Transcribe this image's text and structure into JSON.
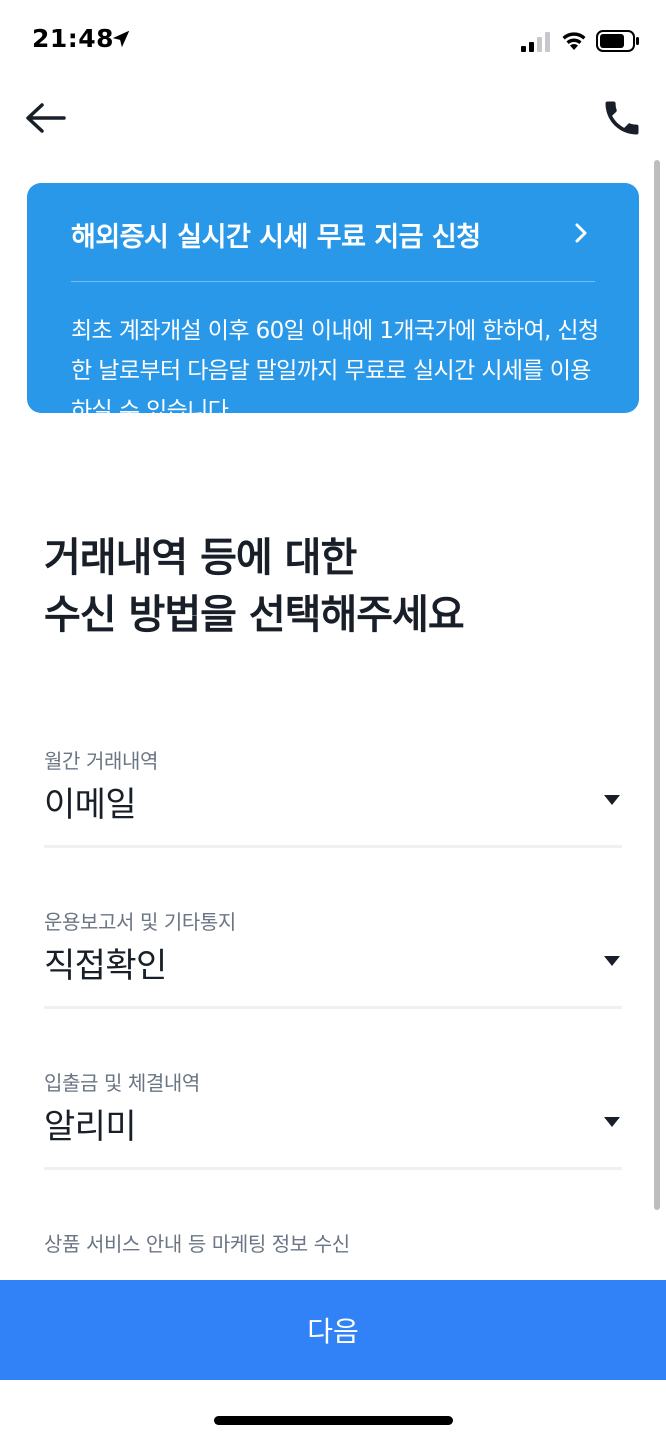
{
  "status_bar": {
    "time": "21:48",
    "icons": [
      "location-arrow-icon",
      "cellular-signal-icon",
      "wifi-icon",
      "battery-icon"
    ]
  },
  "header": {
    "back_icon": "arrow-left-icon",
    "phone_icon": "phone-icon"
  },
  "banner": {
    "title": "해외증시 실시간 시세 무료 지금 신청",
    "description": "최초 계좌개설 이후 60일 이내에 1개국가에 한하여, 신청한 날로부터 다음달 말일까지 무료로 실시간 시세를 이용하실 수 있습니다",
    "chevron_icon": "chevron-right-icon",
    "background_color": "#2a98e8"
  },
  "heading": {
    "line1": "거래내역 등에 대한",
    "line2": "수신 방법을 선택해주세요"
  },
  "fields": [
    {
      "label": "월간 거래내역",
      "value": "이메일"
    },
    {
      "label": "운용보고서 및 기타통지",
      "value": "직접확인"
    },
    {
      "label": "입출금 및 체결내역",
      "value": "알리미"
    },
    {
      "label": "상품 서비스 안내 등 마케팅 정보 수신",
      "value": ""
    }
  ],
  "footer": {
    "next_label": "다음",
    "button_color": "#3182f6"
  }
}
